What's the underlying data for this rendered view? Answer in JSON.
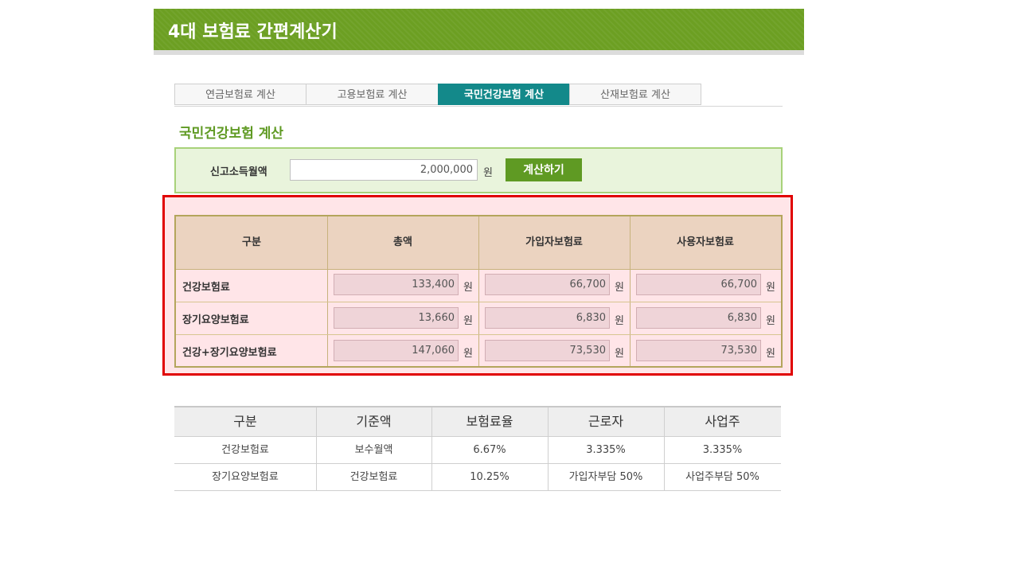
{
  "header": {
    "title": "4대 보험료 간편계산기"
  },
  "tabs": [
    {
      "label": "연금보험료 계산",
      "active": false
    },
    {
      "label": "고용보험료 계산",
      "active": false
    },
    {
      "label": "국민건강보험 계산",
      "active": true
    },
    {
      "label": "산재보험료 계산",
      "active": false
    }
  ],
  "section_title": "국민건강보험 계산",
  "income": {
    "label": "신고소득월액",
    "value": "2,000,000",
    "unit": "원",
    "calc_button": "계산하기"
  },
  "results": {
    "headers": [
      "구분",
      "총액",
      "가입자보험료",
      "사용자보험료"
    ],
    "unit": "원",
    "rows": [
      {
        "label": "건강보험료",
        "total": "133,400",
        "employee": "66,700",
        "employer": "66,700"
      },
      {
        "label": "장기요양보험료",
        "total": "13,660",
        "employee": "6,830",
        "employer": "6,830"
      },
      {
        "label": "건강+장기요양보험료",
        "total": "147,060",
        "employee": "73,530",
        "employer": "73,530"
      }
    ]
  },
  "rates": {
    "headers": [
      "구분",
      "기준액",
      "보험료율",
      "근로자",
      "사업주"
    ],
    "rows": [
      [
        "건강보험료",
        "보수월액",
        "6.67%",
        "3.335%",
        "3.335%"
      ],
      [
        "장기요양보험료",
        "건강보험료",
        "10.25%",
        "가입자부담 50%",
        "사업주부담 50%"
      ]
    ]
  },
  "colors": {
    "header_green": "#6c9f22",
    "active_tab": "#13898a",
    "highlight_border": "#e00000",
    "result_header_bg": "#ebd3c0"
  }
}
